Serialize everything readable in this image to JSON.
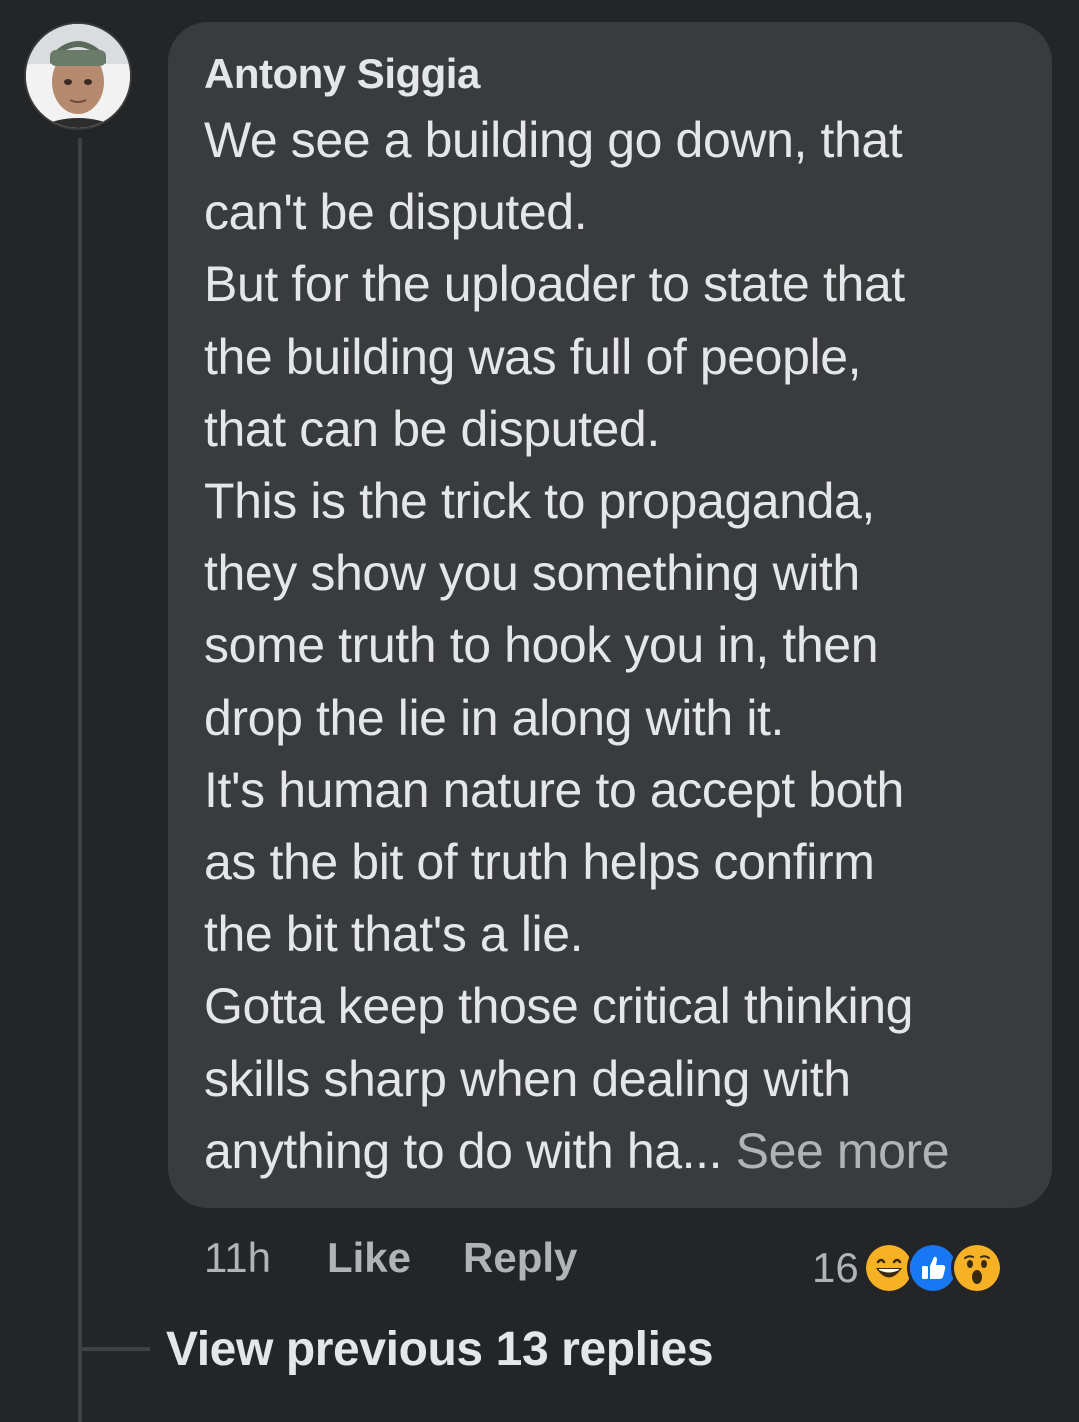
{
  "comment": {
    "author": "Antony Siggia",
    "avatar_icon": "user-avatar",
    "lines": [
      "We see a building go down, that",
      "can't be disputed.",
      "But for the uploader to state that",
      "the building was full of people,",
      "that can be disputed.",
      "This is the trick to propaganda,",
      "they show you something with",
      "some truth to hook you in, then",
      "drop the lie in along with it.",
      "It's human nature to accept both",
      "as the bit of truth helps confirm",
      "the bit that's a lie.",
      "Gotta keep those critical thinking",
      "skills sharp when dealing with",
      "anything to do with ha..."
    ],
    "see_more_label": " See more",
    "time": "11h",
    "like_label": "Like",
    "reply_label": "Reply",
    "reaction_count": "16",
    "reactions": [
      "haha-icon",
      "like-icon",
      "wow-icon"
    ]
  },
  "thread": {
    "view_previous_label": "View previous 13 replies"
  },
  "colors": {
    "background": "#242526",
    "bubble": "#3a3b3c",
    "primary_text": "#e4e6eb",
    "secondary_text": "#b0b3b8",
    "like_blue": "#1877f2",
    "reaction_yellow": "#f7b125"
  }
}
